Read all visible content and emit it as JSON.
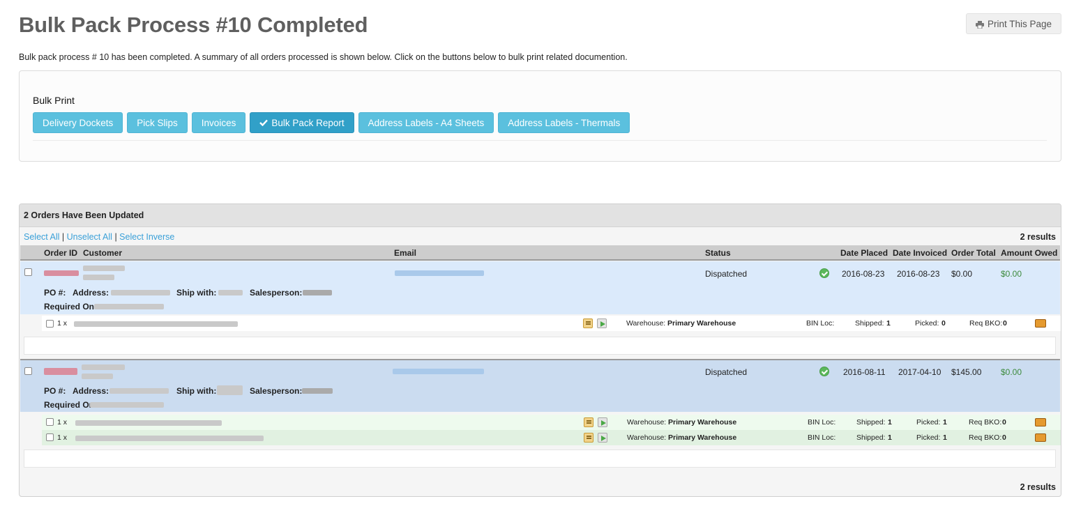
{
  "page": {
    "title": "Bulk Pack Process #10 Completed",
    "print_label": "Print This Page",
    "intro": "Bulk pack process # 10 has been completed. A summary of all orders processed is shown below. Click on the buttons below to bulk print related documention."
  },
  "bulk_print": {
    "label": "Bulk Print",
    "buttons": [
      "Delivery Dockets",
      "Pick Slips",
      "Invoices",
      "Bulk Pack Report",
      "Address Labels - A4 Sheets",
      "Address Labels - Thermals"
    ],
    "active_index": 3
  },
  "orders": {
    "header": "2 Orders Have Been Updated",
    "select_all": "Select All",
    "unselect_all": "Unselect All",
    "select_inverse": "Select Inverse",
    "separator": "|",
    "results": "2 results",
    "columns": {
      "order_id": "Order ID",
      "customer": "Customer",
      "email": "Email",
      "status": "Status",
      "date_placed": "Date Placed",
      "date_invoiced": "Date Invoiced",
      "order_total": "Order Total",
      "amount_owed": "Amount Owed"
    },
    "labels": {
      "po": "PO #:",
      "address": "Address:",
      "ship_with": "Ship with:",
      "salesperson": "Salesperson:",
      "required_on": "Required On",
      "qty": "1 x",
      "warehouse": "Warehouse:",
      "bin_loc": "BIN Loc:",
      "shipped": "Shipped:",
      "picked": "Picked:",
      "req_bko": "Req BKO:"
    },
    "rows": [
      {
        "status": "Dispatched",
        "date_placed": "2016-08-23",
        "date_invoiced": "2016-08-23",
        "order_total": "$0.00",
        "amount_owed": "$0.00",
        "lines": [
          {
            "warehouse": "Primary Warehouse",
            "shipped": "1",
            "picked": "0",
            "req_bko": "0"
          }
        ]
      },
      {
        "status": "Dispatched",
        "date_placed": "2016-08-11",
        "date_invoiced": "2017-04-10",
        "order_total": "$145.00",
        "amount_owed": "$0.00",
        "lines": [
          {
            "warehouse": "Primary Warehouse",
            "shipped": "1",
            "picked": "1",
            "req_bko": "0"
          },
          {
            "warehouse": "Primary Warehouse",
            "shipped": "1",
            "picked": "1",
            "req_bko": "0"
          }
        ]
      }
    ]
  }
}
